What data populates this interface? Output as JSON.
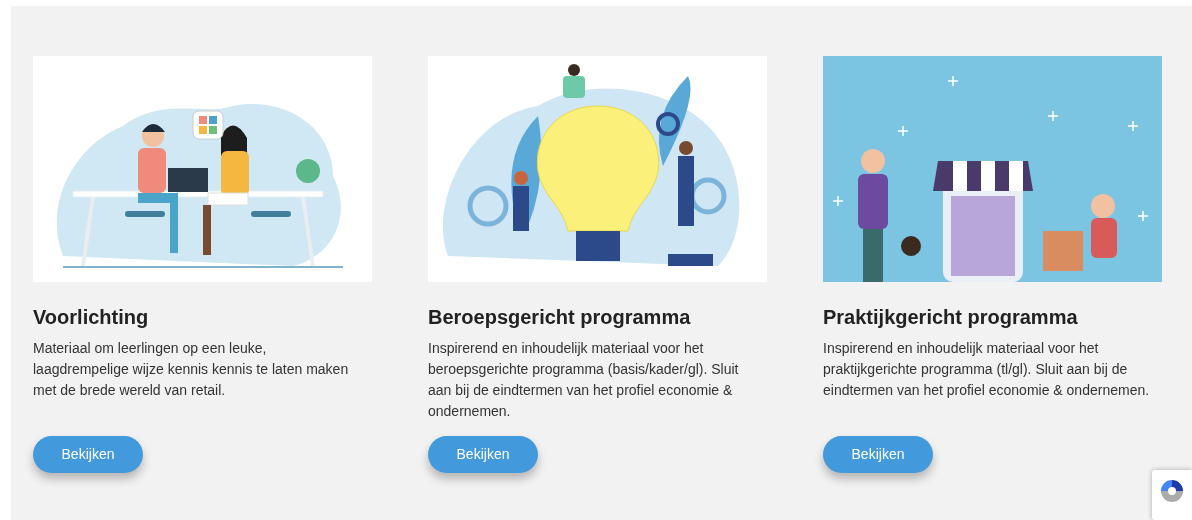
{
  "cards": [
    {
      "title": "Voorlichting",
      "description": "Materiaal om leerlingen op een leuke, laagdrempelige wijze kennis kennis te laten maken met de brede wereld van retail.",
      "button": "Bekijken"
    },
    {
      "title": "Beroepsgericht programma",
      "description": "Inspirerend en inhoudelijk materiaal voor het beroepsgerichte programma (basis/kader/gl). Sluit aan bij de eindtermen van het profiel economie & ondernemen.",
      "button": "Bekijken"
    },
    {
      "title": "Praktijkgericht programma",
      "description": "Inspirerend en inhoudelijk materiaal voor het praktijkgerichte programma (tl/gl). Sluit aan bij de eindtermen van het profiel economie & ondernemen.",
      "button": "Bekijken"
    }
  ]
}
